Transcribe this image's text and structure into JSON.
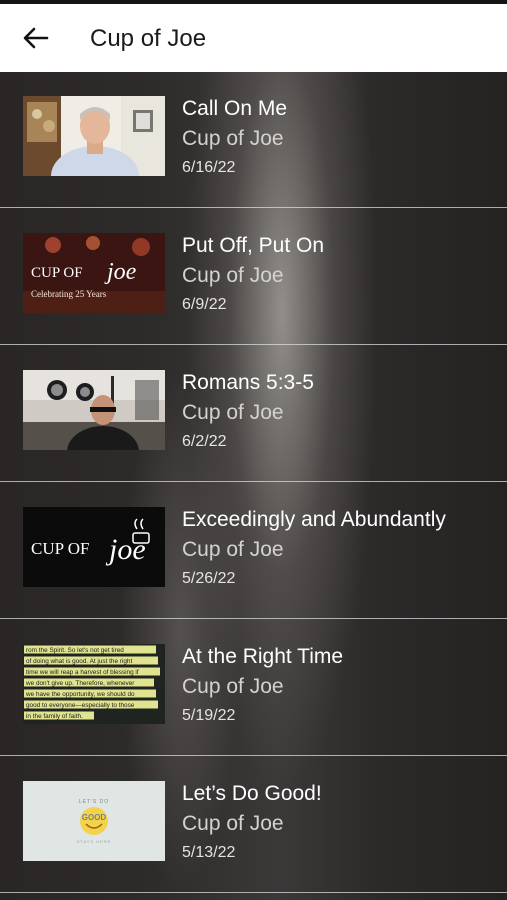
{
  "header": {
    "back_icon": "arrow-left-icon",
    "title": "Cup of Joe"
  },
  "episodes": [
    {
      "title": "Call On Me",
      "show": "Cup of Joe",
      "date": "6/16/22",
      "thumbnail": "man-in-office-video-still"
    },
    {
      "title": "Put Off, Put On",
      "show": "Cup of Joe",
      "date": "6/9/22",
      "thumbnail": "cup-of-joe-logo-celebrating-25-years",
      "thumbnail_text": {
        "brand_left": "CUP OF",
        "brand_right": "joe",
        "tagline": "Celebrating 25 Years"
      }
    },
    {
      "title": "Romans 5:3-5",
      "show": "Cup of Joe",
      "date": "6/2/22",
      "thumbnail": "man-in-living-room-video-still"
    },
    {
      "title": "Exceedingly and Abundantly",
      "show": "Cup of Joe",
      "date": "5/26/22",
      "thumbnail": "cup-of-joe-logo-black",
      "thumbnail_text": {
        "brand_left": "CUP OF",
        "brand_right": "joe"
      }
    },
    {
      "title": "At the Right Time",
      "show": "Cup of Joe",
      "date": "5/19/22",
      "thumbnail": "highlighted-scripture-text",
      "thumbnail_text": {
        "lines": [
          "rom the Spirit. So let's not get tired",
          "of doing what is good. At just the right",
          "time we will reap a harvest of blessing if",
          "we don't give up. Therefore, whenever",
          "we have the opportunity, we should do",
          "good to everyone—especially to those",
          "in the family of faith."
        ]
      }
    },
    {
      "title": "Let’s Do Good!",
      "show": "Cup of Joe",
      "date": "5/13/22",
      "thumbnail": "lets-do-good-smiley-logo",
      "thumbnail_text": {
        "top": "LET'S DO",
        "middle": "GOOD",
        "bottom": "STAYS HERE"
      }
    }
  ],
  "colors": {
    "header_bg": "#ffffff",
    "list_bg": "#2a2727",
    "title_text": "#ffffff",
    "subtitle_text": "#d4d2d0",
    "highlight": "#f1f59a"
  }
}
